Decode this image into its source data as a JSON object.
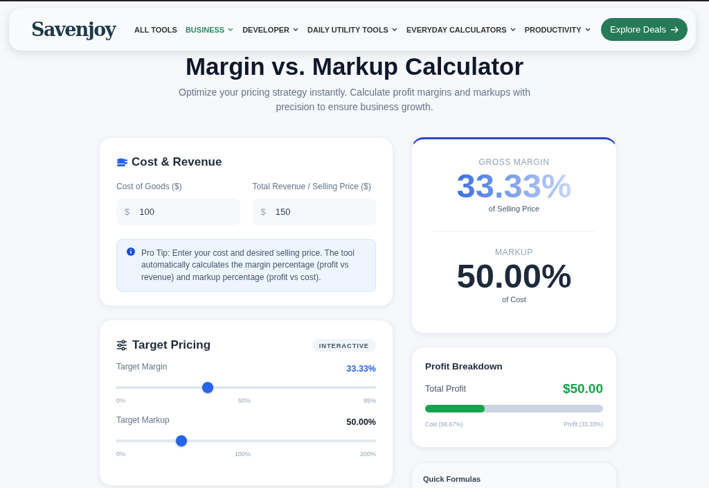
{
  "header": {
    "logo": "Savenjoy",
    "nav": [
      {
        "label": "ALL TOOLS",
        "selected": false,
        "dropdown": false
      },
      {
        "label": "BUSINESS",
        "selected": true,
        "dropdown": true
      },
      {
        "label": "DEVELOPER",
        "selected": false,
        "dropdown": true
      },
      {
        "label": "DAILY UTILITY TOOLS",
        "selected": false,
        "dropdown": true
      },
      {
        "label": "EVERYDAY CALCULATORS",
        "selected": false,
        "dropdown": true
      },
      {
        "label": "PRODUCTIVITY",
        "selected": false,
        "dropdown": true
      }
    ],
    "cta": "Explore Deals"
  },
  "title": "Margin vs. Markup Calculator",
  "subtitle": "Optimize your pricing strategy instantly. Calculate profit margins and markups with precision to ensure business growth.",
  "cost_revenue": {
    "title": "Cost & Revenue",
    "fields": [
      {
        "label": "Cost of Goods ($)",
        "prefix": "$",
        "value": "100"
      },
      {
        "label": "Total Revenue / Selling Price ($)",
        "prefix": "$",
        "value": "150"
      }
    ],
    "tip": "Pro Tip: Enter your cost and desired selling price. The tool automatically calculates the margin percentage (profit vs revenue) and markup percentage (profit vs cost)."
  },
  "target_pricing": {
    "title": "Target Pricing",
    "badge": "INTERACTIVE",
    "sliders": [
      {
        "label": "Target Margin",
        "reading": "33.33%",
        "highlight": true,
        "level": 0.351,
        "ticks": [
          "0%",
          "50%",
          "95%"
        ]
      },
      {
        "label": "Target Markup",
        "reading": "50.00%",
        "highlight": false,
        "level": 0.25,
        "ticks": [
          "0%",
          "100%",
          "200%"
        ]
      }
    ]
  },
  "results": [
    {
      "label": "GROSS MARGIN",
      "value": "33.33%",
      "caption": "of Selling Price",
      "kind": "gradient"
    },
    {
      "label": "MARKUP",
      "value": "50.00%",
      "caption": "of Cost",
      "kind": "dark"
    }
  ],
  "profit_breakdown": {
    "title": "Profit Breakdown",
    "label": "Total Profit",
    "value": "$50.00",
    "level": 0.333,
    "left": "Cost (66.67%)",
    "right": "Profit (33.33%)"
  },
  "quick_formulas": {
    "title": "Quick Formulas"
  }
}
